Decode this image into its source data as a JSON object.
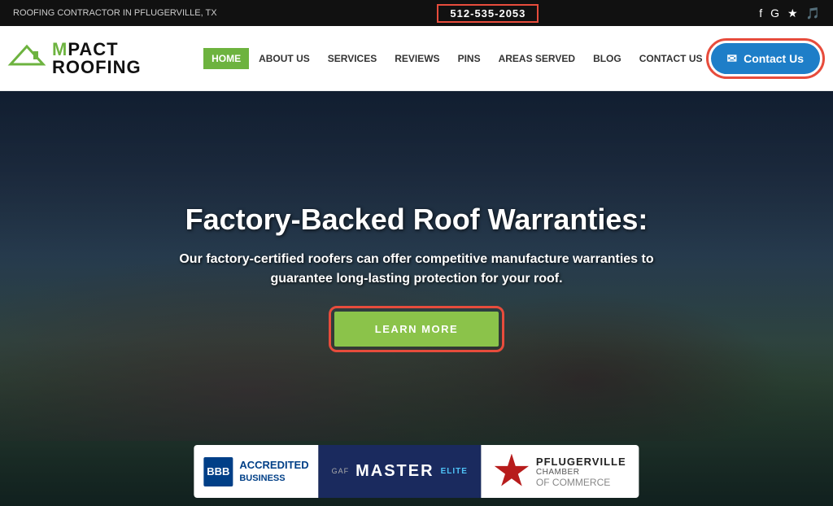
{
  "topbar": {
    "location_text": "ROOFING CONTRACTOR IN PFLUGERVILLE, TX",
    "phone": "512-535-2053",
    "social_icons": [
      "f",
      "G",
      "★",
      "♪"
    ]
  },
  "header": {
    "logo_prefix": "M",
    "logo_brand": "PACT ROOFING",
    "contact_btn_label": "Contact Us"
  },
  "nav": {
    "items": [
      {
        "label": "HOME",
        "active": true
      },
      {
        "label": "ABOUT US",
        "active": false
      },
      {
        "label": "SERVICES",
        "active": false
      },
      {
        "label": "REVIEWS",
        "active": false
      },
      {
        "label": "PINS",
        "active": false
      },
      {
        "label": "AREAS SERVED",
        "active": false
      },
      {
        "label": "BLOG",
        "active": false
      },
      {
        "label": "CONTACT US",
        "active": false
      }
    ]
  },
  "hero": {
    "title": "Factory-Backed Roof Warranties:",
    "subtitle": "Our factory-certified roofers can offer competitive manufacture warranties to guarantee long-lasting protection for your roof.",
    "cta_label": "LEARN MORE"
  },
  "badges": {
    "bbb": {
      "icon_text": "BBB",
      "line1": "ACCREDITED",
      "line2": "BUSINESS"
    },
    "gaf": {
      "eyebrow": "GAF",
      "title": "MASTER",
      "subtitle": "ELITE"
    },
    "chamber": {
      "city": "PFLUGERVILLE",
      "line2": "CHAMBER",
      "line3": "OF COMMERCE"
    }
  },
  "colors": {
    "green": "#6db33f",
    "blue": "#1e7ec8",
    "red": "#e74c3c",
    "dark": "#111111"
  }
}
